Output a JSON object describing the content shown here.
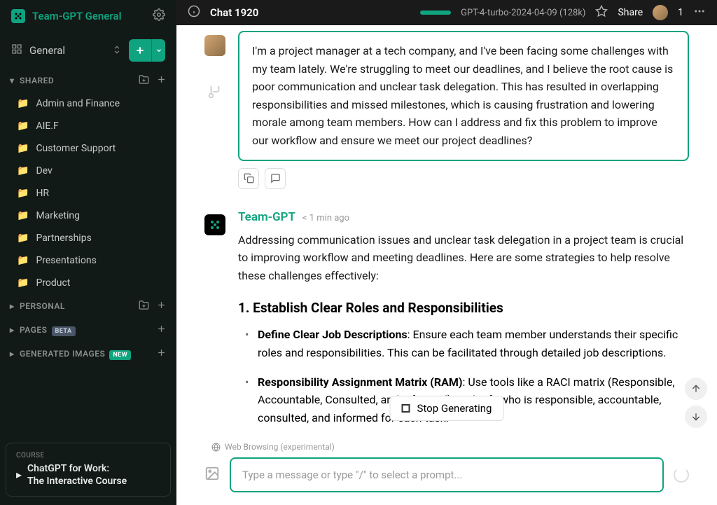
{
  "sidebar": {
    "team_name": "Team-GPT General",
    "general": "General",
    "sections": {
      "shared": "SHARED",
      "personal": "PERSONAL",
      "pages": "PAGES",
      "generated_images": "GENERATED IMAGES"
    },
    "folders": [
      "Admin and Finance",
      "AIE.F",
      "Customer Support",
      "Dev",
      "HR",
      "Marketing",
      "Partnerships",
      "Presentations",
      "Product"
    ],
    "badges": {
      "beta": "BETA",
      "new": "NEW"
    },
    "course": {
      "label": "COURSE",
      "title_line1": "ChatGPT for Work:",
      "title_line2": "The Interactive Course"
    }
  },
  "topbar": {
    "chat_title": "Chat 1920",
    "model": "GPT-4-turbo-2024-04-09 (128k)",
    "share": "Share",
    "user_count": "1"
  },
  "messages": {
    "user_prompt": "I'm a project manager at a tech company, and I've been facing some challenges with my team lately. We're struggling to meet our deadlines, and I believe the root cause is poor communication and unclear task delegation. This has resulted in overlapping responsibilities and missed milestones, which is causing frustration and lowering morale among team members. How can I address and fix this problem to improve our workflow and ensure we meet our project deadlines?",
    "bot_name": "Team-GPT",
    "bot_time": "< 1 min ago",
    "bot_intro": "Addressing communication issues and unclear task delegation in a project team is crucial to improving workflow and meeting deadlines. Here are some strategies to help resolve these challenges effectively:",
    "bot_h1": "1. Establish Clear Roles and Responsibilities",
    "bot_li1_strong": "Define Clear Job Descriptions",
    "bot_li1_rest": ": Ensure each team member understands their specific roles and responsibilities. This can be facilitated through detailed job descriptions.",
    "bot_li2_strong": "Responsibility Assignment Matrix (RAM)",
    "bot_li2_rest": ": Use tools like a RACI matrix (Responsible, Accountable, Consulted, and Informed) to clarify who is responsible, accountable, consulted, and informed for each task."
  },
  "controls": {
    "stop_generating": "Stop Generating",
    "web_browsing": "Web Browsing (experimental)",
    "input_placeholder": "Type a message or type \"/\" to select a prompt..."
  }
}
